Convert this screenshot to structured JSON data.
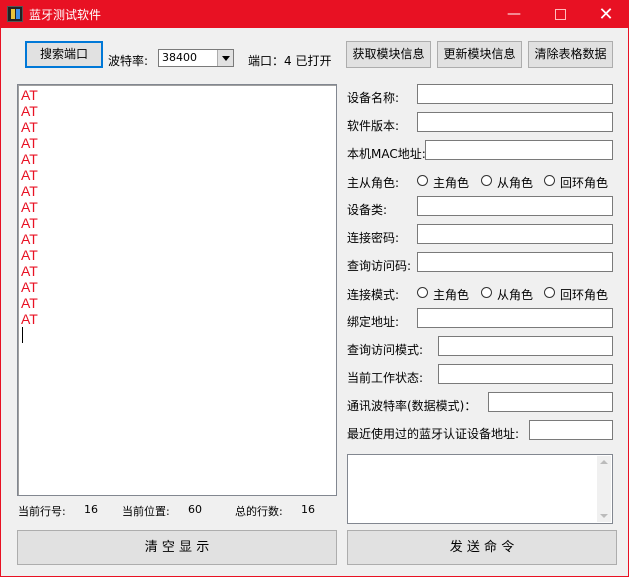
{
  "window": {
    "title": "蓝牙测试软件",
    "controls": {
      "minimize": "—",
      "close": "✕"
    }
  },
  "toolbar": {
    "search_port_label": "搜索端口",
    "baud_label": "波特率:",
    "baud_value": "38400",
    "port_status": "端口：4 已打开",
    "get_info_label": "获取模块信息",
    "update_info_label": "更新模块信息",
    "clear_table_label": "清除表格数据"
  },
  "log": {
    "lines": [
      "AT",
      "AT",
      "AT",
      "AT",
      "AT",
      "AT",
      "AT",
      "AT",
      "AT",
      "AT",
      "AT",
      "AT",
      "AT",
      "AT",
      "AT"
    ]
  },
  "form": {
    "device_name": "设备名称:",
    "firmware_version": "软件版本:",
    "mac_address": "本机MAC地址:",
    "role_label": "主从角色:",
    "role_options": [
      "主角色",
      "从角色",
      "回环角色"
    ],
    "device_class": "设备类:",
    "pairing_password": "连接密码:",
    "inquiry_access_code": "查询访问码:",
    "connect_mode_label": "连接模式:",
    "connect_mode_options": [
      "主角色",
      "从角色",
      "回环角色"
    ],
    "bind_address": "绑定地址:",
    "inquiry_access_mode": "查询访问模式:",
    "work_state": "当前工作状态:",
    "uart_baud": "通讯波特率(数据模式)：",
    "last_paired_address": "最近使用过的蓝牙认证设备地址:"
  },
  "status": {
    "current_line_label": "当前行号:",
    "current_line_value": "16",
    "current_pos_label": "当前位置:",
    "current_pos_value": "60",
    "total_lines_label": "总的行数:",
    "total_lines_value": "16"
  },
  "bottom": {
    "clear_display_label": "清 空 显 示",
    "send_command_label": "发 送 命 令"
  },
  "colors": {
    "titlebar": "#e81123",
    "log_text": "#e81123",
    "window_bg": "#f0f0f0"
  }
}
